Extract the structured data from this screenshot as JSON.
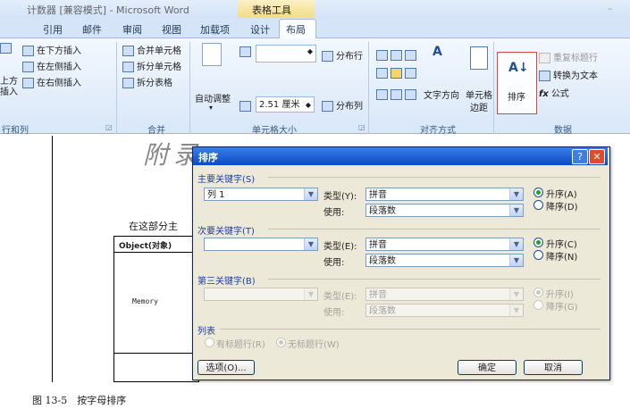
{
  "window": {
    "title": "计数器 [兼容模式] - Microsoft Word",
    "context_group": "表格工具",
    "min_glyph": "–"
  },
  "tabs": [
    "引用",
    "邮件",
    "审阅",
    "视图",
    "加载项",
    "设计",
    "布局"
  ],
  "ribbon": {
    "rows_cols": {
      "insert_below": "在下方插入",
      "insert_left": "在左侧插入",
      "insert_right": "在右侧插入",
      "insert_above_partial": "上方",
      "insert_partial2": "插入",
      "label": "行和列"
    },
    "merge": {
      "merge_cells": "合并单元格",
      "split_cells": "拆分单元格",
      "split_table": "拆分表格",
      "label": "合并"
    },
    "cell_size": {
      "autofit": "自动调整",
      "width_value": "2.51 厘米",
      "distribute_rows": "分布行",
      "distribute_cols": "分布列",
      "label": "单元格大小"
    },
    "alignment": {
      "text_direction": "文字方向",
      "cell_margins_1": "单元格",
      "cell_margins_2": "边距",
      "label": "对齐方式"
    },
    "data": {
      "sort": "排序",
      "repeat_header": "重复标题行",
      "convert_text": "转换为文本",
      "formula": "公式",
      "label": "数据"
    }
  },
  "document": {
    "heading_deco": "附录",
    "text": "在这部分主",
    "table_header": "Object(对象)",
    "cell_text": "Memory",
    "caption": "图 13-5　按字母排序"
  },
  "dialog": {
    "title": "排序",
    "help": "?",
    "close": "✕",
    "primary": {
      "section": "主要关键字(S)",
      "key": "列 1",
      "type_label": "类型(Y):",
      "type_value": "拼音",
      "use_label": "使用:",
      "use_value": "段落数",
      "asc": "升序(A)",
      "desc": "降序(D)"
    },
    "secondary": {
      "section": "次要关键字(T)",
      "key": "",
      "type_label": "类型(E):",
      "type_value": "拼音",
      "use_label": "使用:",
      "use_value": "段落数",
      "asc": "升序(C)",
      "desc": "降序(N)"
    },
    "tertiary": {
      "section": "第三关键字(B)",
      "key": "",
      "type_label": "类型(E):",
      "type_value": "拼音",
      "use_label": "使用:",
      "use_value": "段落数",
      "asc": "升序(I)",
      "desc": "降序(G)"
    },
    "list": {
      "section": "列表",
      "has_header": "有标题行(R)",
      "no_header": "无标题行(W)"
    },
    "options_button": "选项(O)...",
    "ok_button": "确定",
    "cancel_button": "取消"
  }
}
